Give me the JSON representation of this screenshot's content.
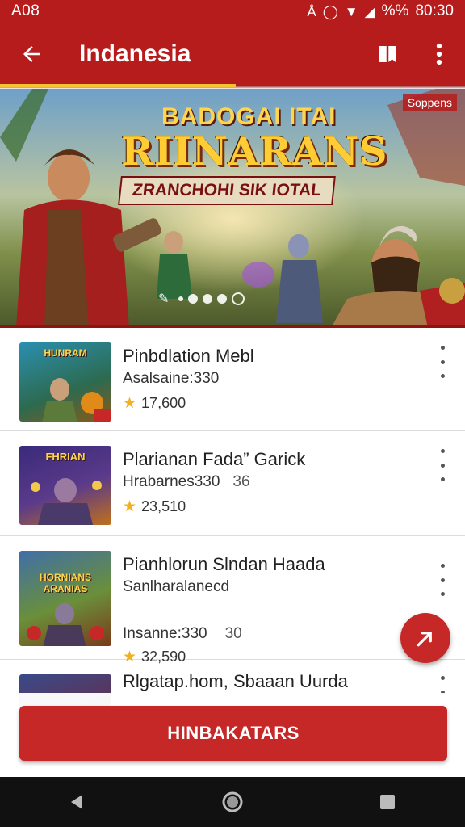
{
  "status_bar": {
    "left_text": "A08",
    "battery_text": "%%",
    "time": "80:30"
  },
  "app_bar": {
    "title": "Indanesia"
  },
  "banner": {
    "tag": "Soppens",
    "line1": "BADOGAI ITAI",
    "line2": "RIINARANS",
    "line3": "ZRANCHOHI SIK IOTAL",
    "dots": 5,
    "active_dot": 4
  },
  "games": [
    {
      "name": "Pinbdlation Mebl",
      "sub": "Asalsaine:330",
      "extra": "",
      "rating": "17,600",
      "thumb_label": "HUNRAM",
      "thumb_bg": "#2d6a4f"
    },
    {
      "name": "Plarianan Fada” Garick",
      "sub": "Hrabarnes330",
      "extra": "36",
      "rating": "23,510",
      "thumb_label": "FHRIAN",
      "thumb_bg": "#5b3a8a"
    },
    {
      "name": "Pianhlorun Slndan Haada",
      "sub": "Sanlharalanecd",
      "extra": "",
      "rating": "",
      "thumb_label": "HORNIANS ARANIAS",
      "thumb_bg": "#3f6fa8"
    },
    {
      "name": "Rlgatap.hom, Sbaaan Uurda",
      "sub": "",
      "extra": "",
      "rating": "",
      "thumb_label": "",
      "thumb_bg": "#7a1f2a"
    }
  ],
  "row3_line2": {
    "text": "Insanne:330",
    "extra": "30"
  },
  "row3_rating": "32,590",
  "bottom_button": "HINBAKATARS",
  "colors": {
    "primary": "#b71c1c",
    "button": "#c62828",
    "accent": "#f4c430",
    "star": "#f2b01e"
  }
}
